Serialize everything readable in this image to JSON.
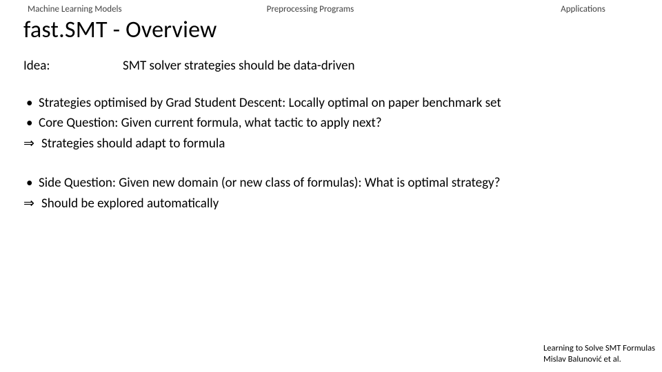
{
  "tabs": {
    "t1": "Machine Learning Models",
    "t2": "Preprocessing Programs",
    "t3": "Applications"
  },
  "title": "fast.SMT - Overview",
  "idea": {
    "label": "Idea:",
    "text": "SMT solver strategies should be data-driven"
  },
  "bullets1": {
    "b1": "Strategies optimised by Grad Student Descent: Locally optimal on paper benchmark set",
    "b2": "Core Question: Given current formula, what tactic to apply next?",
    "arrow": "Strategies should adapt to formula"
  },
  "bullets2": {
    "b1": "Side Question: Given new domain (or new class of formulas): What is optimal strategy?",
    "arrow": "Should be explored automatically"
  },
  "arrow_symbol": "⇒",
  "footer": {
    "line1": "Learning to Solve SMT Formulas",
    "line2": "Mislav Balunović et al."
  }
}
